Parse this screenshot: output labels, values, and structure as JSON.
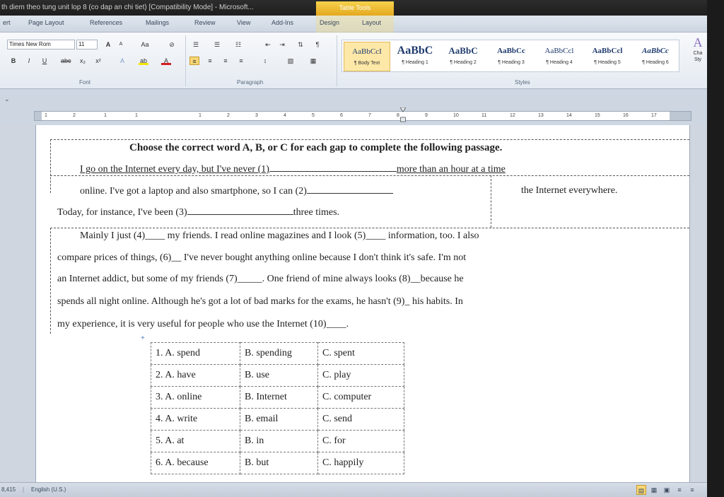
{
  "window": {
    "title": "th diem theo tung unit lop 8 (co dap an chi tiet) [Compatibility Mode] - Microsoft...",
    "context_tab": "Table Tools"
  },
  "tabs": [
    "ert",
    "Page Layout",
    "References",
    "Mailings",
    "Review",
    "View",
    "Add-Ins",
    "Design",
    "Layout"
  ],
  "ribbon": {
    "font": {
      "name": "Times New Rom",
      "size": "11",
      "grow": "A",
      "shrink": "A",
      "change_case": "Aa",
      "clear": "⊘",
      "bold": "B",
      "italic": "I",
      "underline": "U",
      "strike": "abc",
      "subscript": "x₂",
      "superscript": "x²",
      "effects": "A",
      "highlight": "ab",
      "color": "A",
      "label": "Font"
    },
    "paragraph": {
      "bullets": "☰",
      "numbering": "☰",
      "multilevel": "☷",
      "decrease_indent": "⇤",
      "increase_indent": "⇥",
      "sort": "⇅",
      "show_marks": "¶",
      "align_left": "≡",
      "center": "≡",
      "align_right": "≡",
      "justify": "≡",
      "line_spacing": "↕",
      "shading": "▧",
      "borders": "▦",
      "label": "Paragraph"
    },
    "styles": {
      "items": [
        {
          "sample": "AaBbCcI",
          "name": "¶ Body Text"
        },
        {
          "sample": "AaBbC",
          "name": "¶ Heading 1"
        },
        {
          "sample": "AaBbC",
          "name": "¶ Heading 2"
        },
        {
          "sample": "AaBbCc",
          "name": "¶ Heading 3"
        },
        {
          "sample": "AaBbCcl",
          "name": "¶ Heading 4"
        },
        {
          "sample": "AaBbCcl",
          "name": "¶ Heading 5"
        },
        {
          "sample": "AaBbCc",
          "name": "¶ Heading 6"
        }
      ],
      "change_styles": "Cha Sty",
      "label": "Styles"
    }
  },
  "ruler": {
    "ticks": [
      "1",
      "2",
      "1",
      "1",
      "1",
      "2",
      "3",
      "4",
      "5",
      "6",
      "7",
      "8",
      "9",
      "10",
      "11",
      "12",
      "13",
      "14",
      "15",
      "16",
      "17"
    ]
  },
  "document": {
    "title": "Choose the correct word A, B, or C for each gap to complete the following passage.",
    "line1a": "I go on the Internet every day, but I've never (1)",
    "line1b": "more than an hour at a time",
    "line2a": "online. I've got a laptop and also smartphone, so I can (2)",
    "line2b": "the Internet everywhere.",
    "line3a": "Today, for instance, I've been (3)",
    "line3b": "three times.",
    "para": [
      "Mainly I just (4)____ my friends.  I read online magazines and I look (5)____ information, too.  I also",
      "compare prices  of things,  (6)__ I've never bought  anything online because  I  don't think it's safe. I'm not",
      "an Internet addict, but some of my friends (7)_____. One friend of mine always looks (8)__because       he",
      "spends all night online.  Although he's got a lot of bad marks  for the exams, he hasn't (9)_ his habits. In",
      "my experience, it is very useful for people who use the Internet (10)____."
    ],
    "table_handle": "+",
    "options": [
      [
        "1. A. spend",
        "B. spending",
        "C. spent"
      ],
      [
        "2. A. have",
        "B. use",
        "C. play"
      ],
      [
        "3. A. online",
        "B. Internet",
        "C. computer"
      ],
      [
        "4. A. write",
        "B. email",
        "C. send"
      ],
      [
        "5. A. at",
        "B. in",
        "C. for"
      ],
      [
        "6. A. because",
        "B. but",
        "C. happily"
      ]
    ]
  },
  "statusbar": {
    "words": "8,415",
    "language": "English (U.S.)"
  },
  "colors": {
    "context_tab": "#e4a81f",
    "ribbon_bg": "#e4eaf1",
    "page": "#ffffff"
  }
}
